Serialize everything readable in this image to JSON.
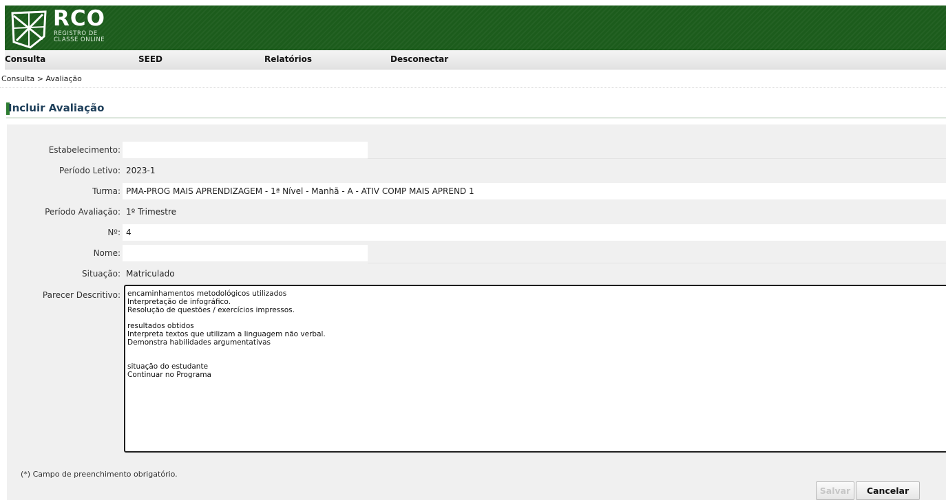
{
  "header": {
    "logo_name": "RCO",
    "logo_sub_line1": "REGISTRO DE",
    "logo_sub_line2": "CLASSE ONLINE"
  },
  "menu": [
    {
      "label": "Consulta"
    },
    {
      "label": "SEED"
    },
    {
      "label": "Relatórios"
    },
    {
      "label": "Desconectar"
    }
  ],
  "breadcrumb": "Consulta > Avaliação",
  "page_title": "Incluir Avaliação",
  "form": {
    "fields": [
      {
        "label": "Estabelecimento:",
        "value": ""
      },
      {
        "label": "Período Letivo:",
        "value": "2023-1"
      },
      {
        "label": "Turma:",
        "value": "PMA-PROG MAIS APRENDIZAGEM - 1ª Nível - Manhã - A - ATIV COMP MAIS APREND 1"
      },
      {
        "label": "Período Avaliação:",
        "value": "1º Trimestre"
      },
      {
        "label": "Nº:",
        "value": "4"
      },
      {
        "label": "Nome:",
        "value": ""
      },
      {
        "label": "Situação:",
        "value": "Matriculado"
      }
    ],
    "parecer_label": "Parecer Descritivo:",
    "parecer_value": "encaminhamentos metodológicos utilizados\nInterpretação de infográfico.\nResolução de questões / exercícios impressos.\n\nresultados obtidos\nInterpreta textos que utilizam a linguagem não verbal.\nDemonstra habilidades argumentativas\n\n\nsituação do estudante\nContinuar no Programa",
    "required_note": "(*) Campo de preenchimento obrigatório.",
    "save_label": "Salvar",
    "cancel_label": "Cancelar"
  },
  "colors": {
    "header_green": "#1c5c1c",
    "title_accent": "#2e7d32",
    "title_text": "#1e3f5a"
  }
}
